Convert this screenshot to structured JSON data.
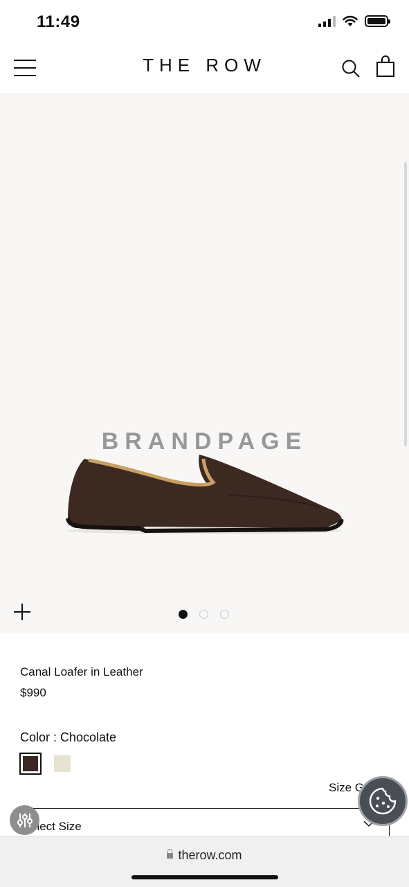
{
  "status_bar": {
    "time": "11:49",
    "icons": [
      "cellular-signal-icon",
      "wifi-icon",
      "battery-icon"
    ]
  },
  "header": {
    "logo": "THE ROW",
    "icons": [
      "hamburger-menu-icon",
      "search-icon",
      "shopping-bag-icon"
    ]
  },
  "gallery": {
    "watermark": "BRANDPAGE",
    "slide_count": 3,
    "active_slide": 1,
    "background": "#f8f7f5"
  },
  "product": {
    "name": "Canal Loafer in Leather",
    "price": "$990",
    "color_label": "Color : Chocolate",
    "swatches": [
      {
        "name": "Chocolate",
        "hex": "#3b2a24",
        "selected": true
      },
      {
        "name": "Ivory",
        "hex": "#e6e3d0",
        "selected": false
      }
    ],
    "size_guide": "Size G",
    "size_select": "elect Size"
  },
  "floating": {
    "filter_icon": "sliders-icon",
    "cookie_icon": "cookie-icon"
  },
  "browser": {
    "url": "therow.com"
  }
}
